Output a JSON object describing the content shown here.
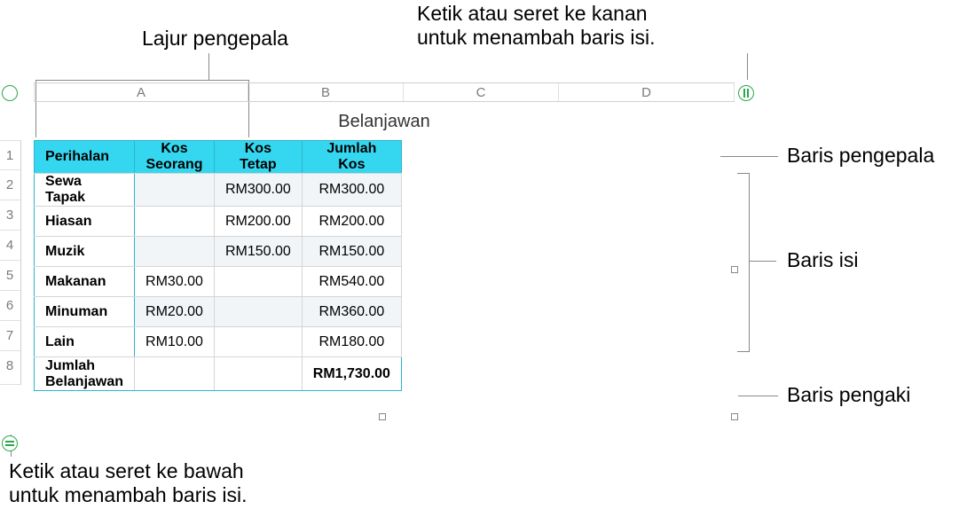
{
  "callouts": {
    "top_left": "Lajur pengepala",
    "top_right_l1": "Ketik atau seret ke kanan",
    "top_right_l2": "untuk menambah baris isi.",
    "right_header": "Baris pengepala",
    "right_body": "Baris isi",
    "right_footer": "Baris pengaki",
    "bottom_l1": "Ketik atau seret ke bawah",
    "bottom_l2": "untuk menambah baris isi."
  },
  "table": {
    "title": "Belanjawan",
    "columns": {
      "A": "A",
      "B": "B",
      "C": "C",
      "D": "D"
    },
    "row_numbers": [
      "1",
      "2",
      "3",
      "4",
      "5",
      "6",
      "7",
      "8"
    ],
    "header": {
      "perihalan": "Perihalan",
      "kos_seorang": "Kos Seorang",
      "kos_tetap": "Kos Tetap",
      "jumlah_kos": "Jumlah Kos"
    },
    "rows": [
      {
        "perihalan": "Sewa Tapak",
        "kos_seorang": "",
        "kos_tetap": "RM300.00",
        "jumlah_kos": "RM300.00"
      },
      {
        "perihalan": "Hiasan",
        "kos_seorang": "",
        "kos_tetap": "RM200.00",
        "jumlah_kos": "RM200.00"
      },
      {
        "perihalan": "Muzik",
        "kos_seorang": "",
        "kos_tetap": "RM150.00",
        "jumlah_kos": "RM150.00"
      },
      {
        "perihalan": "Makanan",
        "kos_seorang": "RM30.00",
        "kos_tetap": "",
        "jumlah_kos": "RM540.00"
      },
      {
        "perihalan": "Minuman",
        "kos_seorang": "RM20.00",
        "kos_tetap": "",
        "jumlah_kos": "RM360.00"
      },
      {
        "perihalan": "Lain",
        "kos_seorang": "RM10.00",
        "kos_tetap": "",
        "jumlah_kos": "RM180.00"
      }
    ],
    "footer": {
      "perihalan": "Jumlah Belanjawan",
      "kos_seorang": "",
      "kos_tetap": "",
      "jumlah_kos": "RM1,730.00"
    }
  }
}
